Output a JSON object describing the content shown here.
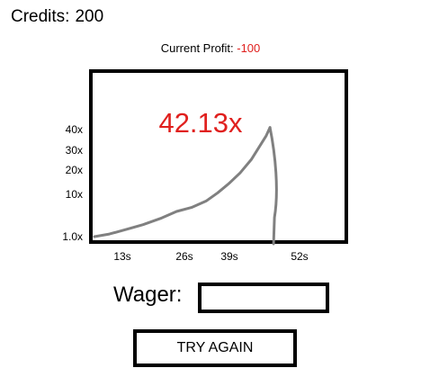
{
  "header": {
    "credits_label": "Credits:",
    "credits_value": "200",
    "profit_label": "Current Profit:",
    "profit_value": "-100"
  },
  "game": {
    "multiplier": "42.13x"
  },
  "chart_data": {
    "type": "line",
    "y_tick_labels": [
      "40x",
      "30x",
      "20x",
      "10x",
      "1.0x"
    ],
    "x_tick_labels": [
      "13s",
      "26s",
      "39s",
      "52s"
    ],
    "series": [
      {
        "x": [
          0,
          4,
          8,
          13,
          18,
          22,
          26,
          30,
          33,
          36,
          39,
          42,
          44,
          46,
          47
        ],
        "y": [
          1.0,
          2.0,
          3.5,
          5.5,
          8.0,
          10.5,
          12.0,
          14.5,
          17.5,
          21.0,
          25.0,
          30.0,
          34.5,
          39.0,
          42.13
        ]
      }
    ],
    "crash_line_color": "#808080",
    "line_color": "#808080",
    "grid": false
  },
  "wager": {
    "label": "Wager:",
    "value": ""
  },
  "actions": {
    "try_again_label": "TRY AGAIN"
  },
  "colors": {
    "accent_red": "#e0201e",
    "border": "#000000",
    "curve": "#808080"
  }
}
